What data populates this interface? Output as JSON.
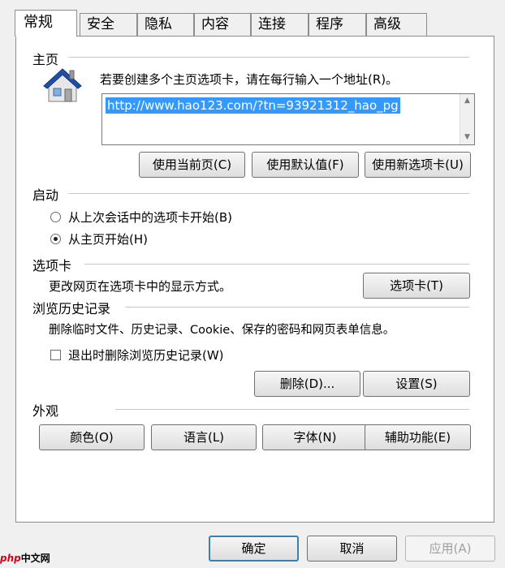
{
  "tabs": [
    "常规",
    "安全",
    "隐私",
    "内容",
    "连接",
    "程序",
    "高级"
  ],
  "homepage": {
    "title": "主页",
    "instruction": "若要创建多个主页选项卡，请在每行输入一个地址(R)。",
    "url": "http://www.hao123.com/?tn=93921312_hao_pg",
    "use_current": "使用当前页(C)",
    "use_default": "使用默认值(F)",
    "use_new_tab": "使用新选项卡(U)"
  },
  "startup": {
    "title": "启动",
    "option_last_session": "从上次会话中的选项卡开始(B)",
    "option_home": "从主页开始(H)",
    "selected": "home"
  },
  "tabs_section": {
    "title": "选项卡",
    "description": "更改网页在选项卡中的显示方式。",
    "button": "选项卡(T)"
  },
  "history": {
    "title": "浏览历史记录",
    "description": "删除临时文件、历史记录、Cookie、保存的密码和网页表单信息。",
    "checkbox_label": "退出时删除浏览历史记录(W)",
    "checked": false,
    "delete_button": "删除(D)...",
    "settings_button": "设置(S)"
  },
  "appearance": {
    "title": "外观",
    "colors": "颜色(O)",
    "languages": "语言(L)",
    "fonts": "字体(N)",
    "accessibility": "辅助功能(E)"
  },
  "footer": {
    "ok": "确定",
    "cancel": "取消",
    "apply": "应用(A)"
  },
  "watermark": {
    "logo": "php",
    "text": "中文网"
  },
  "colors": {
    "selection": "#3399ff",
    "default_border": "#3c7fb1",
    "house_roof": "#1f4fa8"
  }
}
